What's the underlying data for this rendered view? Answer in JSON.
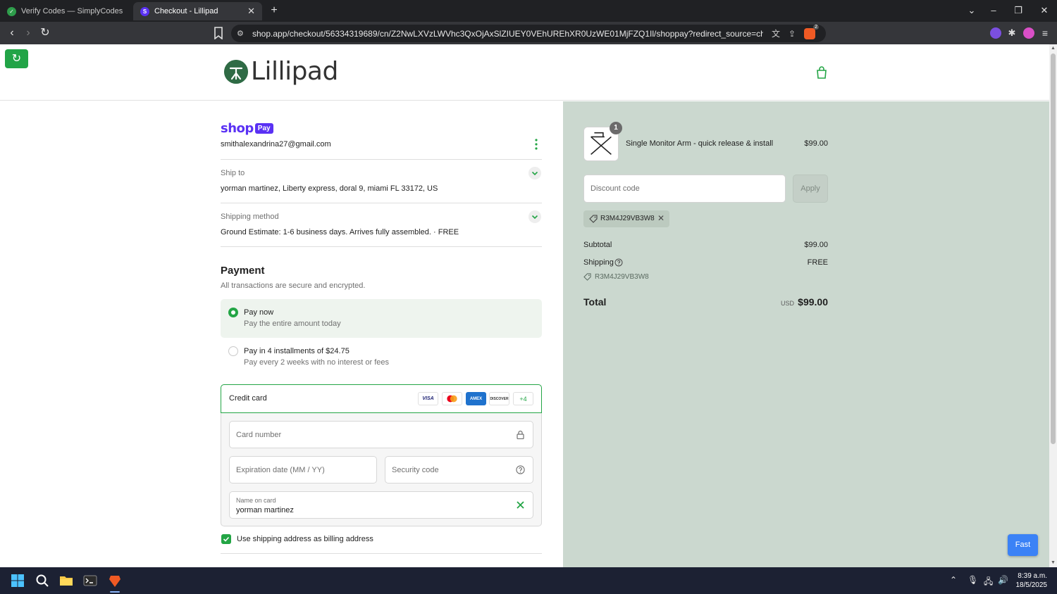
{
  "browser": {
    "tabs": [
      {
        "title": "Verify Codes — SimplyCodes",
        "active": false
      },
      {
        "title": "Checkout - Lillipad",
        "active": true
      }
    ],
    "url": "shop.app/checkout/56334319689/cn/Z2NwLXVzLWVhc3QxOjAxSlZIUEY0VEhUREhXR0UzWE01MjFZQ1Il/shoppay?redirect_source=checkout_universa...",
    "shield_count": "2"
  },
  "page": {
    "brand": "Lillipad",
    "shoppay": {
      "shop": "shop",
      "pay": "Pay"
    },
    "email": "smithalexandrina27@gmail.com",
    "ship_to": {
      "label": "Ship to",
      "value": "yorman martinez, Liberty express, doral 9, miami FL 33172, US"
    },
    "shipping_method": {
      "label": "Shipping method",
      "value": "Ground Estimate: 1-6 business days. Arrives fully assembled. · FREE"
    },
    "payment": {
      "title": "Payment",
      "subtitle": "All transactions are secure and encrypted.",
      "options": [
        {
          "title": "Pay now",
          "subtitle": "Pay the entire amount today",
          "selected": true
        },
        {
          "title": "Pay in 4 installments of $24.75",
          "subtitle": "Pay every 2 weeks with no interest or fees",
          "selected": false
        }
      ],
      "credit_card_label": "Credit card",
      "card_brands": [
        "VISA",
        "MC",
        "AMEX",
        "DISCOVER"
      ],
      "more_brands": "+4",
      "card_number_placeholder": "Card number",
      "expiry_placeholder": "Expiration date (MM / YY)",
      "cvc_placeholder": "Security code",
      "name_label": "Name on card",
      "name_value": "yorman martinez",
      "billing_same_label": "Use shipping address as billing address",
      "billing_same_checked": true
    },
    "summary": {
      "item": {
        "name": "Single Monitor Arm - quick release & install",
        "price": "$99.00",
        "qty": "1"
      },
      "discount_placeholder": "Discount code",
      "apply_label": "Apply",
      "applied_code": "R3M4J29VB3W8",
      "subtotal_label": "Subtotal",
      "subtotal_value": "$99.00",
      "shipping_label": "Shipping",
      "shipping_value": "FREE",
      "code_line": "R3M4J29VB3W8",
      "total_label": "Total",
      "currency": "USD",
      "total_value": "$99.00"
    },
    "fast_button": "Fast"
  },
  "taskbar": {
    "time": "8:39 a.m.",
    "date": "18/5/2025"
  },
  "colors": {
    "accent_green": "#23a545",
    "shop_purple": "#5a31f4",
    "summary_bg": "#cbd8cf"
  }
}
